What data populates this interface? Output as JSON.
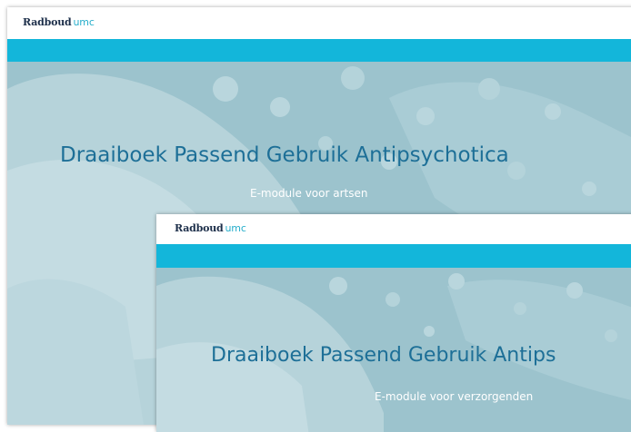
{
  "back_window": {
    "logo": {
      "main": "Radboud",
      "suffix": "umc"
    },
    "title": "Draaiboek Passend Gebruik Antipsychotica",
    "subtitle": "E-module voor artsen"
  },
  "front_window": {
    "logo": {
      "main": "Radboud",
      "suffix": "umc"
    },
    "title": "Draaiboek Passend Gebruik Antips",
    "subtitle": "E-module voor verzorgenden"
  },
  "colors": {
    "header_band": "#13b6da",
    "title_text": "#1d6f97",
    "logo_dark": "#1d2f4a",
    "logo_accent": "#27aecb",
    "hero_tint": "#9cc3cd"
  },
  "icons": {
    "hero_image": "hands-holding-photo"
  }
}
